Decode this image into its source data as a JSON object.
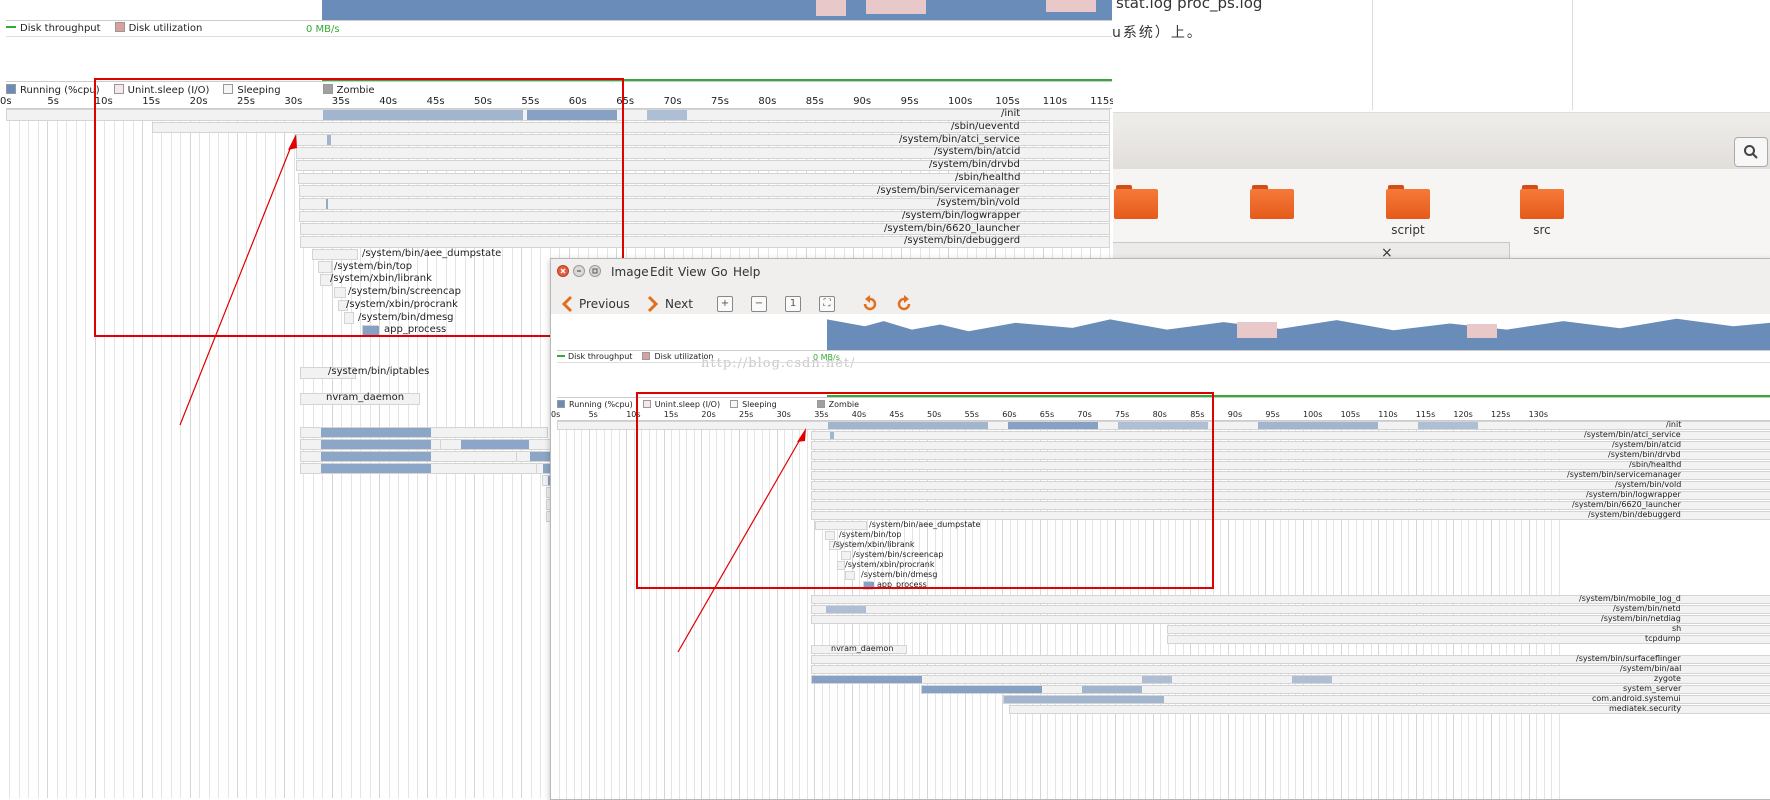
{
  "background": {
    "doc_text_top": "stat.log proc_ps.log",
    "doc_text_line2": "u系统）上。",
    "folders": [
      {
        "label": ""
      },
      {
        "label": ""
      },
      {
        "label": "script"
      },
      {
        "label": "src"
      }
    ],
    "dialog_close": "×"
  },
  "main_chart": {
    "disk_legend": {
      "throughput": "Disk throughput",
      "utilization": "Disk utilization",
      "rate": "0 MB/s"
    },
    "proc_legend": {
      "running": "Running (%cpu)",
      "unint": "Unint.sleep (I/O)",
      "sleeping": "Sleeping",
      "zombie": "Zombie"
    },
    "ticks": [
      "0s",
      "5s",
      "10s",
      "15s",
      "20s",
      "25s",
      "30s",
      "35s",
      "40s",
      "45s",
      "50s",
      "55s",
      "60s",
      "65s",
      "70s",
      "75s",
      "80s",
      "85s",
      "90s",
      "95s",
      "100s",
      "105s",
      "110s",
      "115s"
    ],
    "processes": [
      {
        "name": "/init"
      },
      {
        "name": "/sbin/ueventd"
      },
      {
        "name": "/system/bin/atci_service"
      },
      {
        "name": "/system/bin/atcid"
      },
      {
        "name": "/system/bin/drvbd"
      },
      {
        "name": "/sbin/healthd"
      },
      {
        "name": "/system/bin/servicemanager"
      },
      {
        "name": "/system/bin/vold"
      },
      {
        "name": "/system/bin/logwrapper"
      },
      {
        "name": "/system/bin/6620_launcher"
      },
      {
        "name": "/system/bin/debuggerd"
      },
      {
        "name": "/system/bin/aee_dumpstate"
      },
      {
        "name": "/system/bin/top"
      },
      {
        "name": "/system/xbin/librank"
      },
      {
        "name": "/system/bin/screencap"
      },
      {
        "name": "/system/xbin/procrank"
      },
      {
        "name": "/system/bin/dmesg"
      },
      {
        "name": "app_process"
      },
      {
        "name": "/system/bin/iptables"
      },
      {
        "name": "nvram_daemon"
      }
    ]
  },
  "viewer": {
    "menu": [
      "Image",
      "Edit",
      "View",
      "Go",
      "Help"
    ],
    "toolbar": {
      "previous": "Previous",
      "next": "Next"
    },
    "disk_legend": {
      "throughput": "Disk throughput",
      "utilization": "Disk utilization",
      "rate": "0 MB/s"
    },
    "watermark": "http://blog.csdn.net/",
    "proc_legend": {
      "running": "Running (%cpu)",
      "unint": "Unint.sleep (I/O)",
      "sleeping": "Sleeping",
      "zombie": "Zombie"
    },
    "ticks": [
      "0s",
      "5s",
      "10s",
      "15s",
      "20s",
      "25s",
      "30s",
      "35s",
      "40s",
      "45s",
      "50s",
      "55s",
      "60s",
      "65s",
      "70s",
      "75s",
      "80s",
      "85s",
      "90s",
      "95s",
      "100s",
      "105s",
      "110s",
      "115s",
      "120s",
      "125s",
      "130s"
    ],
    "processes": [
      {
        "name": "/init"
      },
      {
        "name": "/system/bin/atci_service"
      },
      {
        "name": "/system/bin/atcid"
      },
      {
        "name": "/system/bin/drvbd"
      },
      {
        "name": "/sbin/healthd"
      },
      {
        "name": "/system/bin/servicemanager"
      },
      {
        "name": "/system/bin/vold"
      },
      {
        "name": "/system/bin/logwrapper"
      },
      {
        "name": "/system/bin/6620_launcher"
      },
      {
        "name": "/system/bin/debuggerd"
      },
      {
        "name": "/system/bin/aee_dumpstate"
      },
      {
        "name": "/system/bin/top"
      },
      {
        "name": "/system/xbin/librank"
      },
      {
        "name": "/system/bin/screencap"
      },
      {
        "name": "/system/xbin/procrank"
      },
      {
        "name": "/system/bin/dmesg"
      },
      {
        "name": "app_process"
      },
      {
        "name": "/system/bin/mobile_log_d"
      },
      {
        "name": "/system/bin/netd"
      },
      {
        "name": "/system/bin/netdiag"
      },
      {
        "name": "sh"
      },
      {
        "name": "tcpdump"
      },
      {
        "name": "nvram_daemon"
      },
      {
        "name": "/system/bin/surfaceflinger"
      },
      {
        "name": "/system/bin/aal"
      },
      {
        "name": "zygote"
      },
      {
        "name": "system_server"
      },
      {
        "name": "com.android.systemui"
      },
      {
        "name": "mediatek.security"
      }
    ]
  },
  "colors": {
    "running": "#6a8cb8",
    "unint": "#e8c8c8",
    "sleeping": "#f0f0f0",
    "zombie": "#a0a0a0",
    "throughput": "#33aa33",
    "utilization": "#d9a0a0",
    "highlight": "#e00000",
    "folder": "#e8602a"
  }
}
